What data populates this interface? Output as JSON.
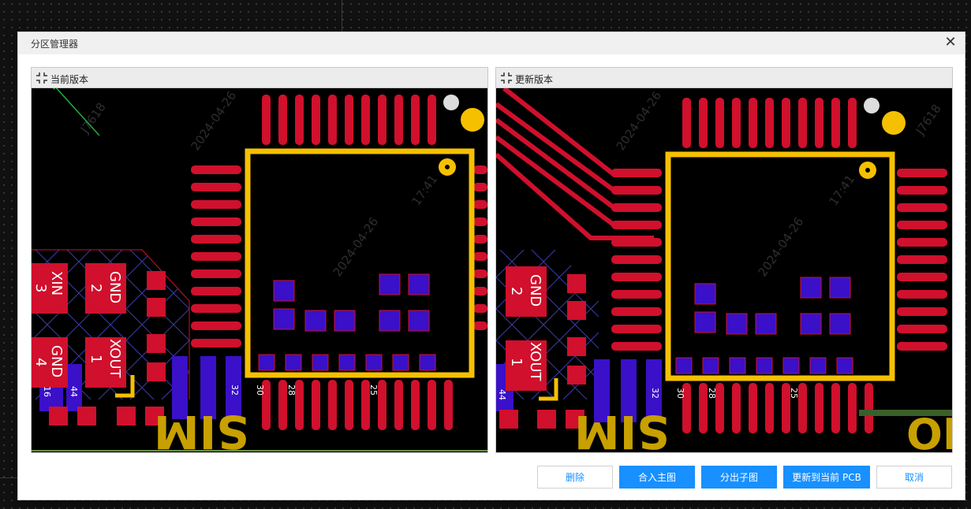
{
  "dialog": {
    "title": "分区管理器",
    "close_icon": "close-icon"
  },
  "left_panel": {
    "label": "当前版本",
    "icon": "collapse-icon",
    "watermark": [
      "J7618",
      "2024-04-26",
      "17:41"
    ],
    "pin_labels": {
      "xin": "XIN",
      "xin_num": "3",
      "gnd_top": "GND",
      "gnd_top_num": "2",
      "gnd_bot": "GND",
      "gnd_bot_num": "4",
      "xout": "XOUT",
      "xout_num": "1",
      "n16": "16",
      "n44": "44",
      "n32": "32",
      "n30": "30",
      "n28": "28",
      "n25": "25",
      "silk": "SIM"
    }
  },
  "right_panel": {
    "label": "更新版本",
    "icon": "collapse-icon",
    "pin_labels": {
      "gnd_top": "GND",
      "gnd_top_num": "2",
      "xout": "XOUT",
      "xout_num": "1",
      "n44": "44",
      "n32": "32",
      "n30": "30",
      "n28": "28",
      "n25": "25",
      "silk": "SIM",
      "silk2": "OI"
    }
  },
  "buttons": {
    "delete": "删除",
    "merge": "合入主图",
    "split": "分出子图",
    "update_pcb": "更新到当前 PCB",
    "cancel": "取消"
  },
  "colors": {
    "pad_red": "#d0102c",
    "pad_blue": "#3a10c8",
    "outline_yellow": "#f5c000",
    "accent_blue": "#1890ff"
  }
}
